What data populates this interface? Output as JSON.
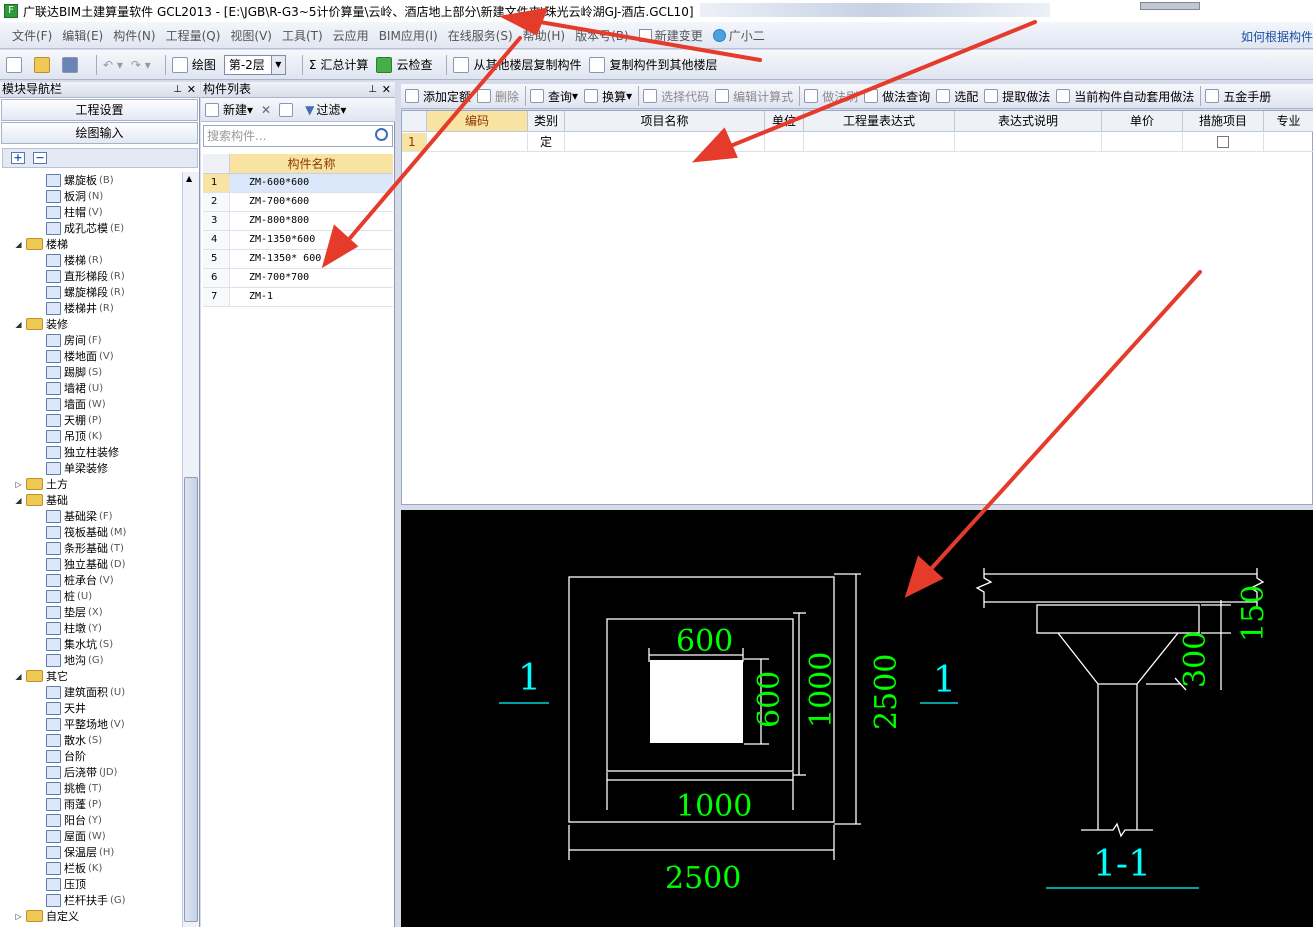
{
  "window": {
    "title": "广联达BIM土建算量软件 GCL2013 - [E:\\JGB\\R-G3~5计价算量\\云岭、酒店地上部分\\新建文件夹\\珠光云岭湖GJ-酒店.GCL10]"
  },
  "menu": {
    "items": [
      "文件(F)",
      "编辑(E)",
      "构件(N)",
      "工程量(Q)",
      "视图(V)",
      "工具(T)",
      "云应用",
      "BIM应用(I)",
      "在线服务(S)",
      "帮助(H)",
      "版本号(B)",
      "新建变更",
      "广小二"
    ],
    "right_link": "如何根据构件"
  },
  "toolbar": {
    "draw_label": "绘图",
    "floor": "第-2层",
    "sum_label": "汇总计算",
    "cloud_check_label": "云检查",
    "copy_from_label": "从其他楼层复制构件",
    "copy_to_label": "复制构件到其他楼层"
  },
  "nav_panel": {
    "title": "模块导航栏",
    "btn_project_settings": "工程设置",
    "btn_draw_input": "绘图输入",
    "tree": [
      {
        "level": 2,
        "label": "螺旋板",
        "key": "(B)"
      },
      {
        "level": 2,
        "label": "板洞",
        "key": "(N)"
      },
      {
        "level": 2,
        "label": "柱帽",
        "key": "(V)"
      },
      {
        "level": 2,
        "label": "成孔芯模",
        "key": "(E)"
      },
      {
        "level": 1,
        "label": "楼梯",
        "key": "",
        "expanded": true
      },
      {
        "level": 2,
        "label": "楼梯",
        "key": "(R)"
      },
      {
        "level": 2,
        "label": "直形梯段",
        "key": "(R)"
      },
      {
        "level": 2,
        "label": "螺旋梯段",
        "key": "(R)"
      },
      {
        "level": 2,
        "label": "楼梯井",
        "key": "(R)"
      },
      {
        "level": 1,
        "label": "装修",
        "key": "",
        "expanded": true
      },
      {
        "level": 2,
        "label": "房间",
        "key": "(F)"
      },
      {
        "level": 2,
        "label": "楼地面",
        "key": "(V)"
      },
      {
        "level": 2,
        "label": "踢脚",
        "key": "(S)"
      },
      {
        "level": 2,
        "label": "墙裙",
        "key": "(U)"
      },
      {
        "level": 2,
        "label": "墙面",
        "key": "(W)"
      },
      {
        "level": 2,
        "label": "天棚",
        "key": "(P)"
      },
      {
        "level": 2,
        "label": "吊顶",
        "key": "(K)"
      },
      {
        "level": 2,
        "label": "独立柱装修",
        "key": ""
      },
      {
        "level": 2,
        "label": "单梁装修",
        "key": ""
      },
      {
        "level": 1,
        "label": "土方",
        "key": "",
        "expanded": false
      },
      {
        "level": 1,
        "label": "基础",
        "key": "",
        "expanded": true
      },
      {
        "level": 2,
        "label": "基础梁",
        "key": "(F)"
      },
      {
        "level": 2,
        "label": "筏板基础",
        "key": "(M)"
      },
      {
        "level": 2,
        "label": "条形基础",
        "key": "(T)"
      },
      {
        "level": 2,
        "label": "独立基础",
        "key": "(D)"
      },
      {
        "level": 2,
        "label": "桩承台",
        "key": "(V)"
      },
      {
        "level": 2,
        "label": "桩",
        "key": "(U)"
      },
      {
        "level": 2,
        "label": "垫层",
        "key": "(X)"
      },
      {
        "level": 2,
        "label": "柱墩",
        "key": "(Y)"
      },
      {
        "level": 2,
        "label": "集水坑",
        "key": "(S)"
      },
      {
        "level": 2,
        "label": "地沟",
        "key": "(G)"
      },
      {
        "level": 1,
        "label": "其它",
        "key": "",
        "expanded": true
      },
      {
        "level": 2,
        "label": "建筑面积",
        "key": "(U)"
      },
      {
        "level": 2,
        "label": "天井",
        "key": ""
      },
      {
        "level": 2,
        "label": "平整场地",
        "key": "(V)"
      },
      {
        "level": 2,
        "label": "散水",
        "key": "(S)"
      },
      {
        "level": 2,
        "label": "台阶",
        "key": ""
      },
      {
        "level": 2,
        "label": "后浇带",
        "key": "(JD)"
      },
      {
        "level": 2,
        "label": "挑檐",
        "key": "(T)"
      },
      {
        "level": 2,
        "label": "雨蓬",
        "key": "(P)"
      },
      {
        "level": 2,
        "label": "阳台",
        "key": "(Y)"
      },
      {
        "level": 2,
        "label": "屋面",
        "key": "(W)"
      },
      {
        "level": 2,
        "label": "保温层",
        "key": "(H)"
      },
      {
        "level": 2,
        "label": "栏板",
        "key": "(K)"
      },
      {
        "level": 2,
        "label": "压顶",
        "key": ""
      },
      {
        "level": 2,
        "label": "栏杆扶手",
        "key": "(G)"
      },
      {
        "level": 1,
        "label": "自定义",
        "key": "",
        "expanded": false
      }
    ]
  },
  "component_list": {
    "title": "构件列表",
    "new_label": "新建",
    "filter_label": "过滤",
    "search_placeholder": "搜索构件...",
    "column_header": "构件名称",
    "rows": [
      {
        "n": "1",
        "name": "ZM-600*600"
      },
      {
        "n": "2",
        "name": "ZM-700*600"
      },
      {
        "n": "3",
        "name": "ZM-800*800"
      },
      {
        "n": "4",
        "name": "ZM-1350*600"
      },
      {
        "n": "5",
        "name": "ZM-1350* 600"
      },
      {
        "n": "6",
        "name": "ZM-700*700"
      },
      {
        "n": "7",
        "name": "ZM-1"
      }
    ]
  },
  "right_toolbar": {
    "items": [
      "添加定额",
      "删除",
      "查询",
      "换算",
      "选择代码",
      "编辑计算式",
      "做法刷",
      "做法查询",
      "选配",
      "提取做法",
      "当前构件自动套用做法",
      "五金手册"
    ]
  },
  "quantity_table": {
    "headers": [
      "编码",
      "类别",
      "项目名称",
      "单位",
      "工程量表达式",
      "表达式说明",
      "单价",
      "措施项目",
      "专业"
    ],
    "row": {
      "n": "1",
      "type": "定"
    }
  },
  "cad": {
    "plan_label": "1",
    "plan_label_right": "1",
    "dim_600_top": "600",
    "dim_600_side": "600",
    "dim_1000_side": "1000",
    "dim_2500_side": "2500",
    "dim_1000_bottom": "1000",
    "dim_2500_bottom": "2500",
    "dim_150": "150",
    "dim_300": "300",
    "section_label": "1-1",
    "colors": {
      "bg": "#000000",
      "line": "#ffffff",
      "dim": "#00ff00",
      "label": "#00ffff",
      "arrow": "#e53b2b"
    }
  }
}
